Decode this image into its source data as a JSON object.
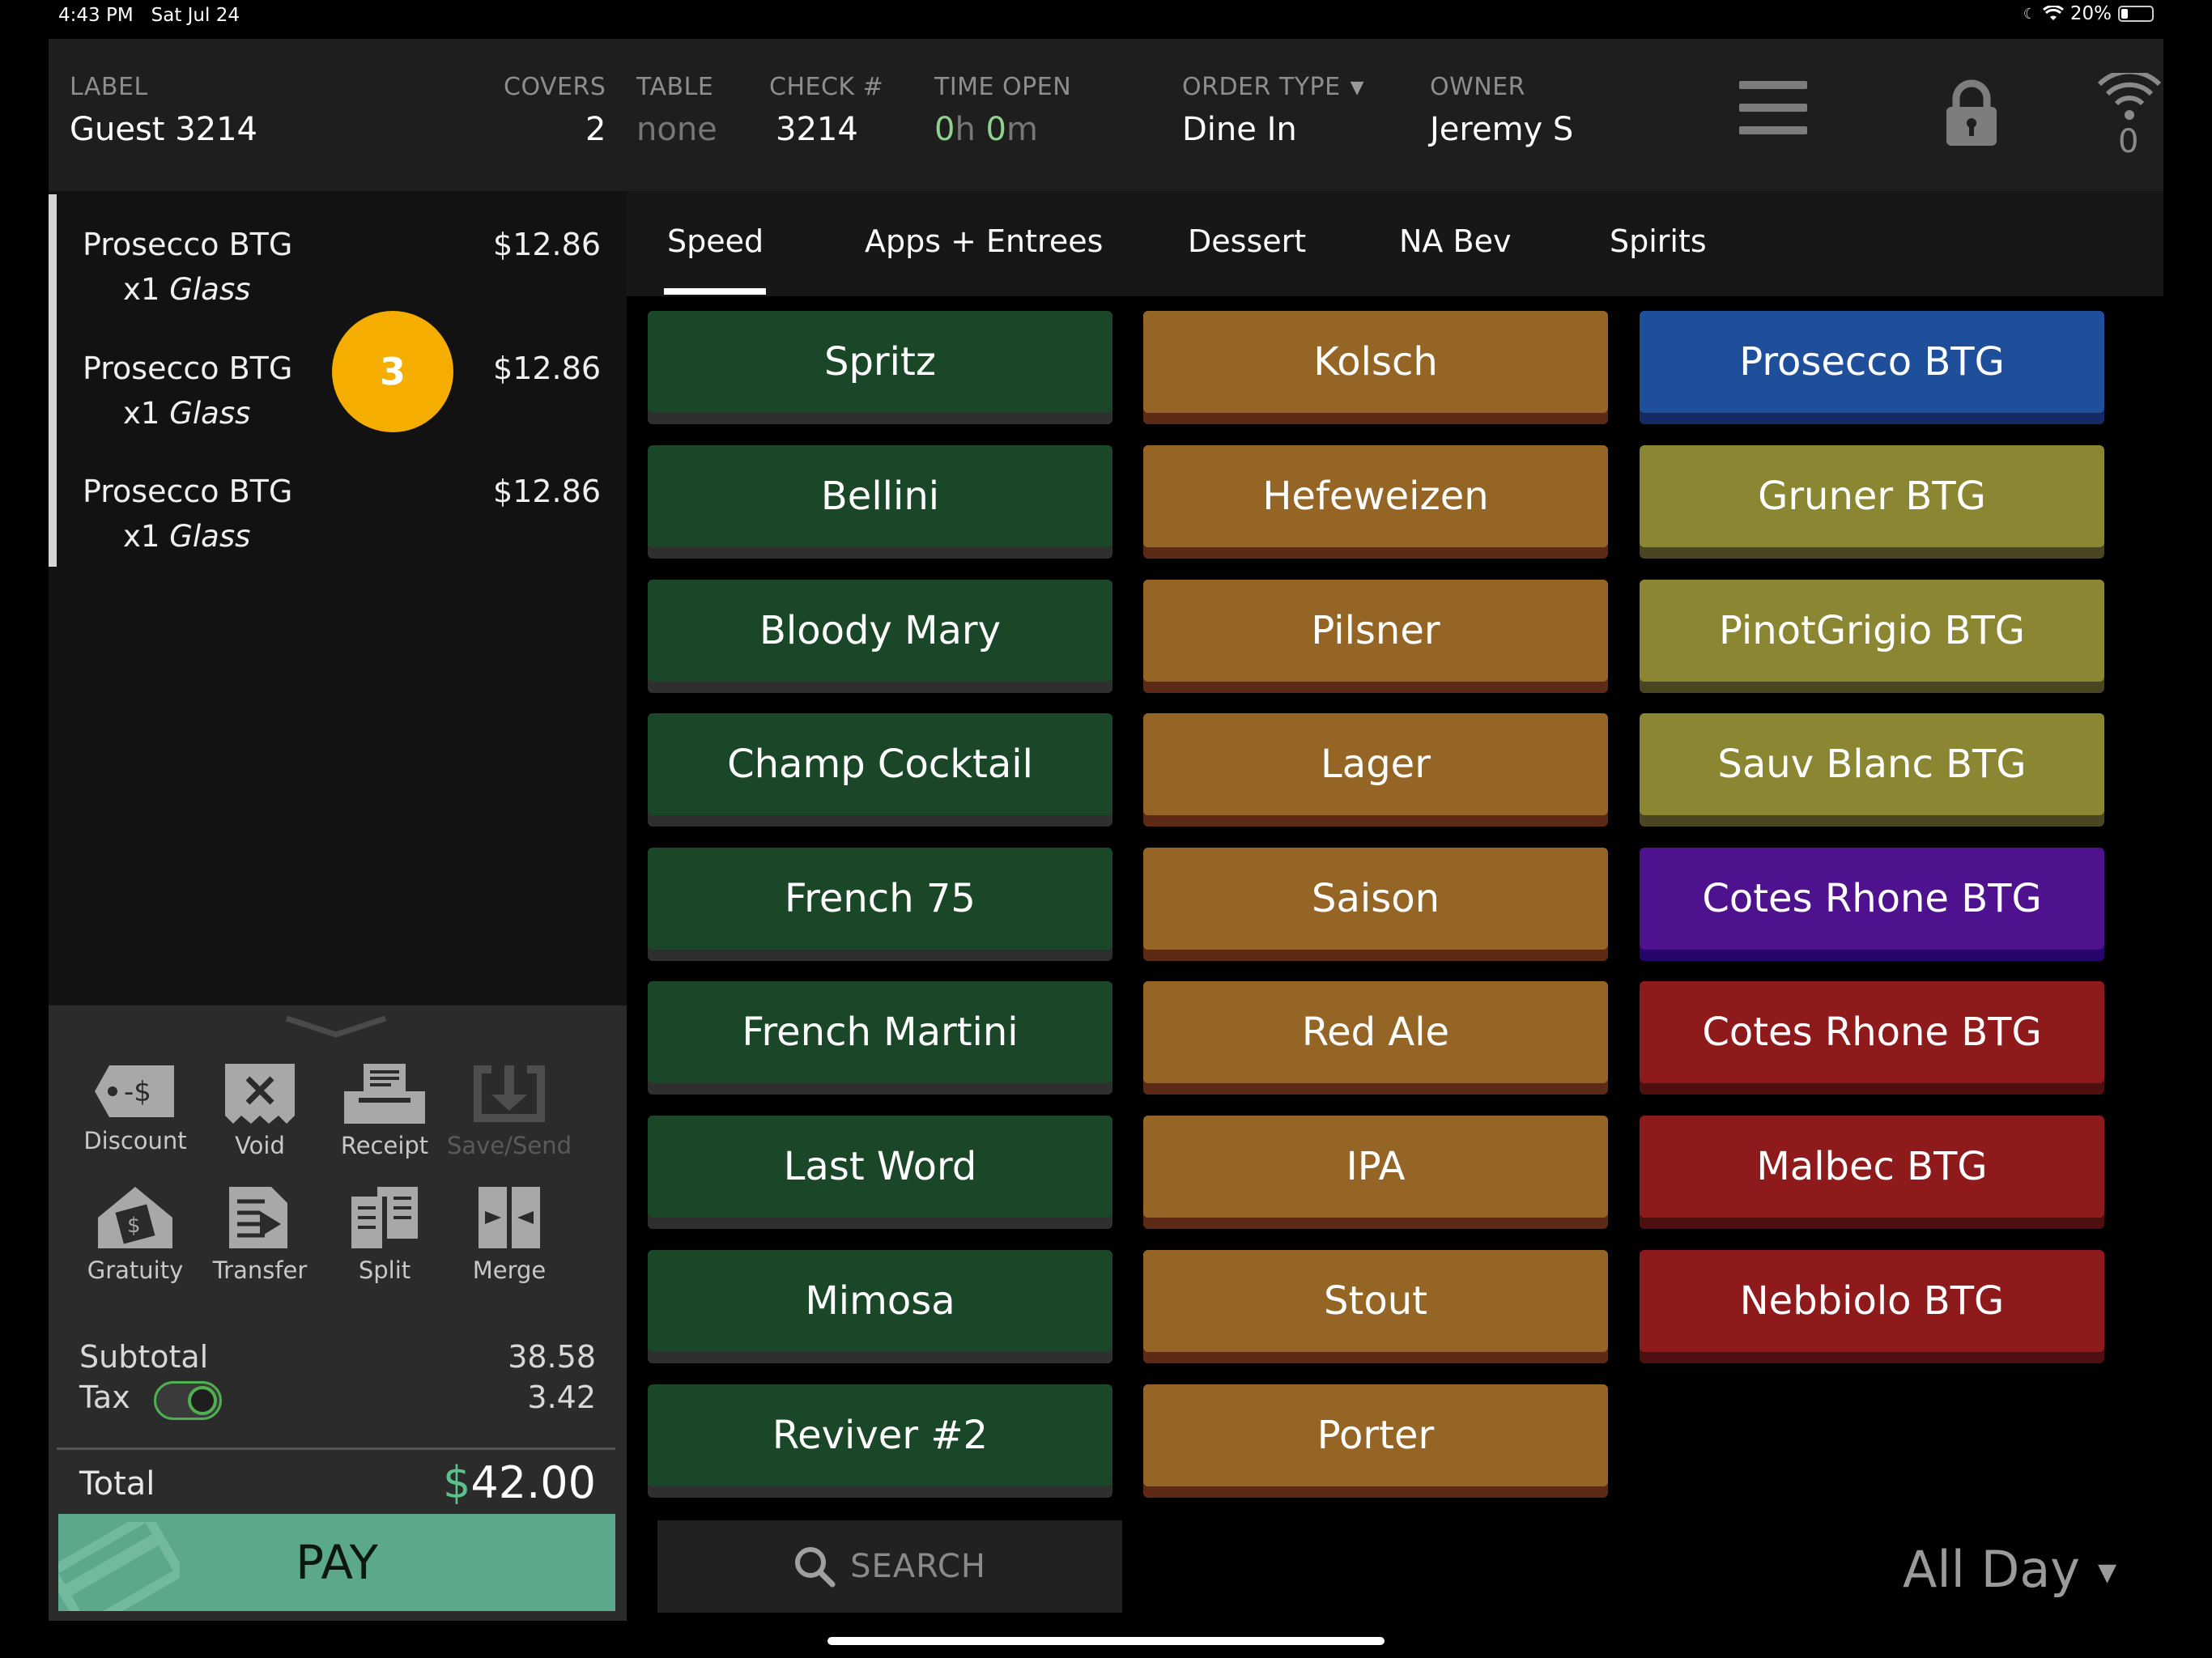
{
  "status_bar": {
    "time": "4:43 PM",
    "date": "Sat Jul 24",
    "battery": "20%"
  },
  "header": {
    "label": {
      "title": "LABEL",
      "value": "Guest 3214"
    },
    "covers": {
      "title": "COVERS",
      "value": "2"
    },
    "table": {
      "title": "TABLE",
      "value": "none"
    },
    "check": {
      "title": "CHECK #",
      "value": "3214"
    },
    "time_open": {
      "title": "TIME OPEN",
      "hours": "0",
      "h": "h",
      "minutes": "0",
      "m": "m"
    },
    "order_type": {
      "title": "ORDER TYPE",
      "value": "Dine In"
    },
    "owner": {
      "title": "OWNER",
      "value": "Jeremy S"
    },
    "wifi_count": "0"
  },
  "order": {
    "items": [
      {
        "name": "Prosecco BTG",
        "price": "$12.86",
        "qty": "x1",
        "modifier": "Glass"
      },
      {
        "name": "Prosecco BTG",
        "price": "$12.86",
        "qty": "x1",
        "modifier": "Glass"
      },
      {
        "name": "Prosecco BTG",
        "price": "$12.86",
        "qty": "x1",
        "modifier": "Glass"
      }
    ],
    "badge": "3"
  },
  "actions": {
    "discount": "Discount",
    "void": "Void",
    "receipt": "Receipt",
    "save_send": "Save/Send",
    "gratuity": "Gratuity",
    "transfer": "Transfer",
    "split": "Split",
    "merge": "Merge",
    "discount_icon_text": "-$"
  },
  "totals": {
    "subtotal_label": "Subtotal",
    "subtotal": "38.58",
    "tax_label": "Tax",
    "tax": "3.42",
    "tax_enabled": true,
    "total_label": "Total",
    "currency": "$",
    "total": "42.00"
  },
  "pay_label": "PAY",
  "tabs": [
    "Speed",
    "Apps + Entrees",
    "Dessert",
    "NA Bev",
    "Spirits"
  ],
  "active_tab": "Speed",
  "menu": {
    "col1": [
      "Spritz",
      "Bellini",
      "Bloody Mary",
      "Champ Cocktail",
      "French 75",
      "French Martini",
      "Last Word",
      "Mimosa",
      "Reviver #2"
    ],
    "col2": [
      "Kolsch",
      "Hefeweizen",
      "Pilsner",
      "Lager",
      "Saison",
      "Red Ale",
      "IPA",
      "Stout",
      "Porter"
    ],
    "col3": [
      "Prosecco BTG",
      "Gruner BTG",
      "PinotGrigio BTG",
      "Sauv Blanc BTG",
      "Cotes Rhone BTG",
      "Cotes Rhone BTG",
      "Malbec BTG",
      "Nebbiolo BTG"
    ]
  },
  "colors": {
    "green": "#1a4727",
    "orange": "#946524",
    "blue": "#1f4f9a",
    "olive": "#8a8632",
    "purple": "#4e128f",
    "red": "#8f1a1c",
    "pay": "#5ca88a",
    "badge": "#f5ae00"
  },
  "search_placeholder": "SEARCH",
  "daypart": "All Day"
}
